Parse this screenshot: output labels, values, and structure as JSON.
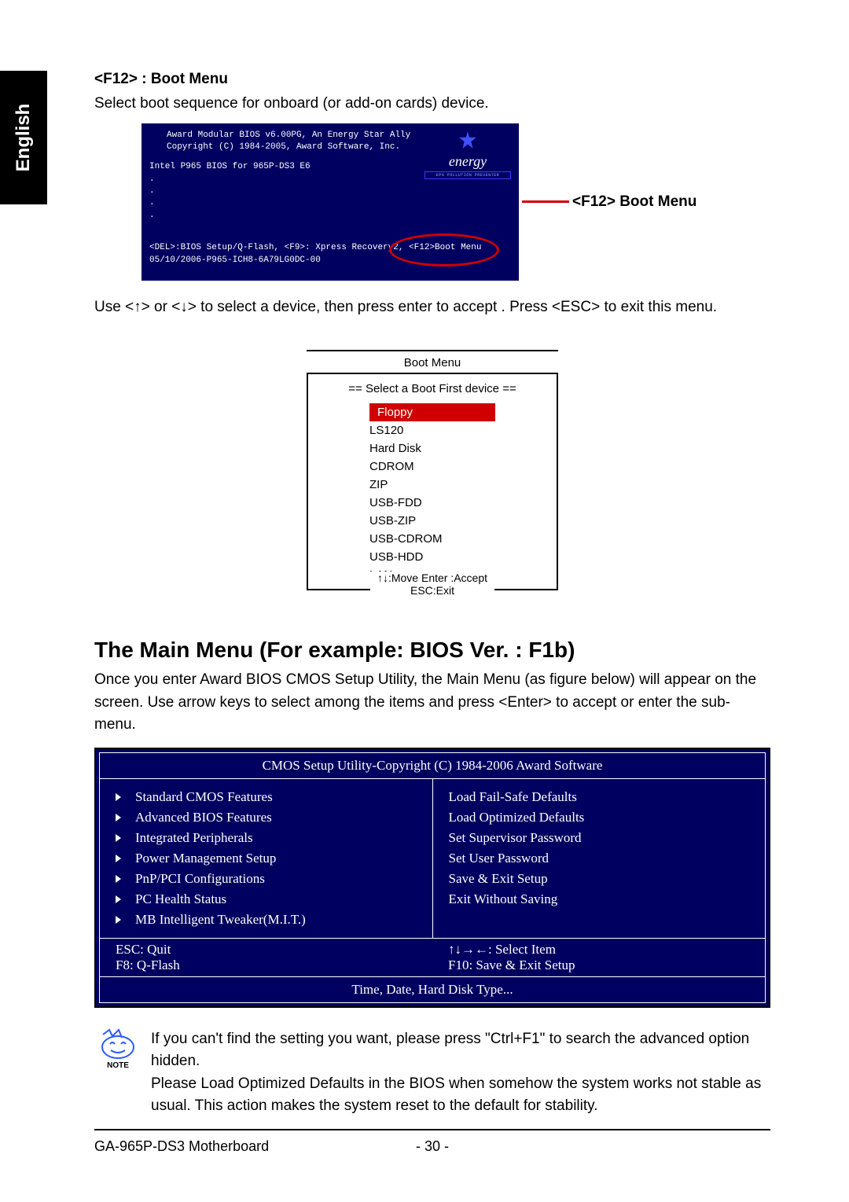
{
  "language_tab": "English",
  "section1": {
    "title": "<F12> : Boot Menu",
    "desc": "Select boot sequence for onboard (or add-on cards) device."
  },
  "bios_screen": {
    "line1": "Award Modular BIOS v6.00PG, An Energy Star Ally",
    "line2": "Copyright (C) 1984-2005, Award Software, Inc.",
    "line3": "Intel P965 BIOS for 965P-DS3 E6",
    "dots": ".",
    "line_bottom1": "<DEL>:BIOS Setup/Q-Flash, <F9>: Xpress Recovery2, <F12>Boot Menu",
    "line_bottom2": "05/10/2006-P965-ICH8-6A79LG0DC-00",
    "logo_main": "energy",
    "logo_sub": "EPA POLLUTION PREVENTER"
  },
  "callout": "<F12> Boot Menu",
  "instruction": "Use <↑> or <↓> to select a device, then press enter to accept . Press <ESC> to exit this menu.",
  "boot_menu": {
    "title": "Boot Menu",
    "subtitle": "== Select a Boot First device ==",
    "items": [
      "Floppy",
      "LS120",
      "Hard Disk",
      "CDROM",
      "ZIP",
      "USB-FDD",
      "USB-ZIP",
      "USB-CDROM",
      "USB-HDD",
      "LAN"
    ],
    "footer": "↑↓:Move  Enter :Accept  ESC:Exit"
  },
  "main_menu": {
    "heading": "The Main Menu (For example: BIOS Ver. : F1b)",
    "para": "Once you enter Award BIOS CMOS Setup Utility, the Main Menu (as figure below) will appear on the screen. Use arrow keys to select among the items and press <Enter> to accept or enter the sub-menu."
  },
  "cmos": {
    "title": "CMOS Setup Utility-Copyright (C) 1984-2006 Award Software",
    "left": [
      "Standard CMOS Features",
      "Advanced BIOS Features",
      "Integrated Peripherals",
      "Power Management Setup",
      "PnP/PCI Configurations",
      "PC Health Status",
      "MB Intelligent Tweaker(M.I.T.)"
    ],
    "right": [
      "Load Fail-Safe Defaults",
      "Load Optimized Defaults",
      "Set Supervisor Password",
      "Set User Password",
      "Save & Exit Setup",
      "Exit Without Saving"
    ],
    "help_l1": "ESC: Quit",
    "help_l2": "F8:  Q-Flash",
    "help_r1": "↑↓→←: Select Item",
    "help_r2": "F10: Save & Exit Setup",
    "hint": "Time, Date, Hard Disk Type..."
  },
  "note": {
    "label": "NOTE",
    "p1": "If you can't find the setting you want, please press \"Ctrl+F1\" to search the advanced option hidden.",
    "p2": "Please Load Optimized Defaults in the BIOS when somehow the system works not stable as usual. This action makes the system reset to the default for stability."
  },
  "footer": {
    "left": "GA-965P-DS3 Motherboard",
    "center": "- 30 -"
  }
}
